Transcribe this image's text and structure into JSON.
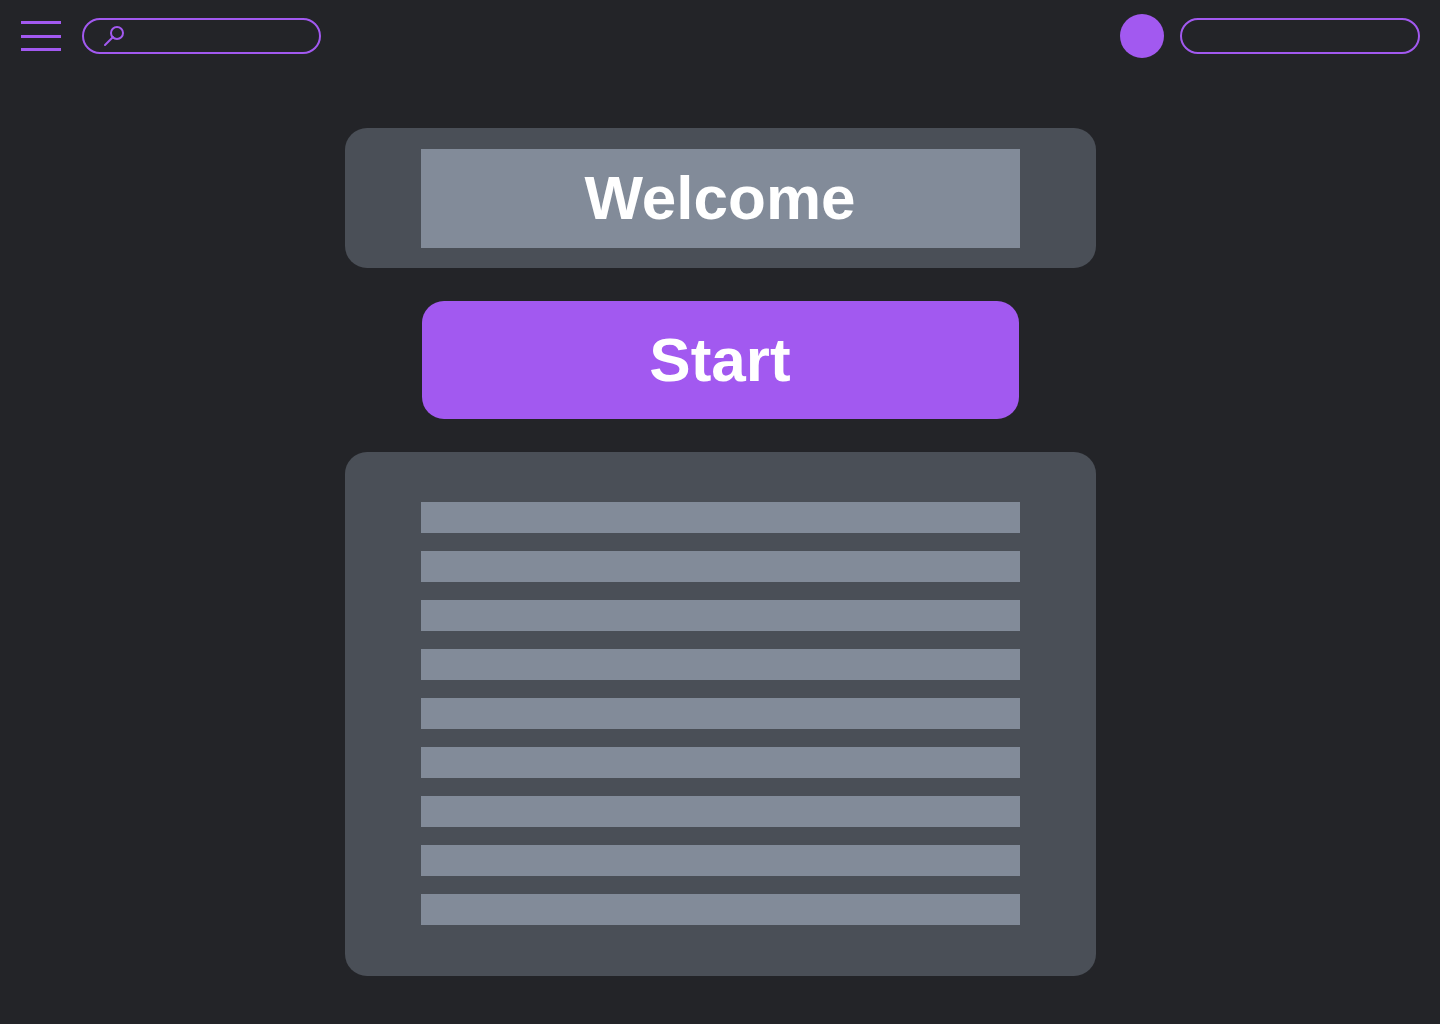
{
  "welcome_card": {
    "title": "Welcome"
  },
  "start_button": {
    "label": "Start"
  }
}
